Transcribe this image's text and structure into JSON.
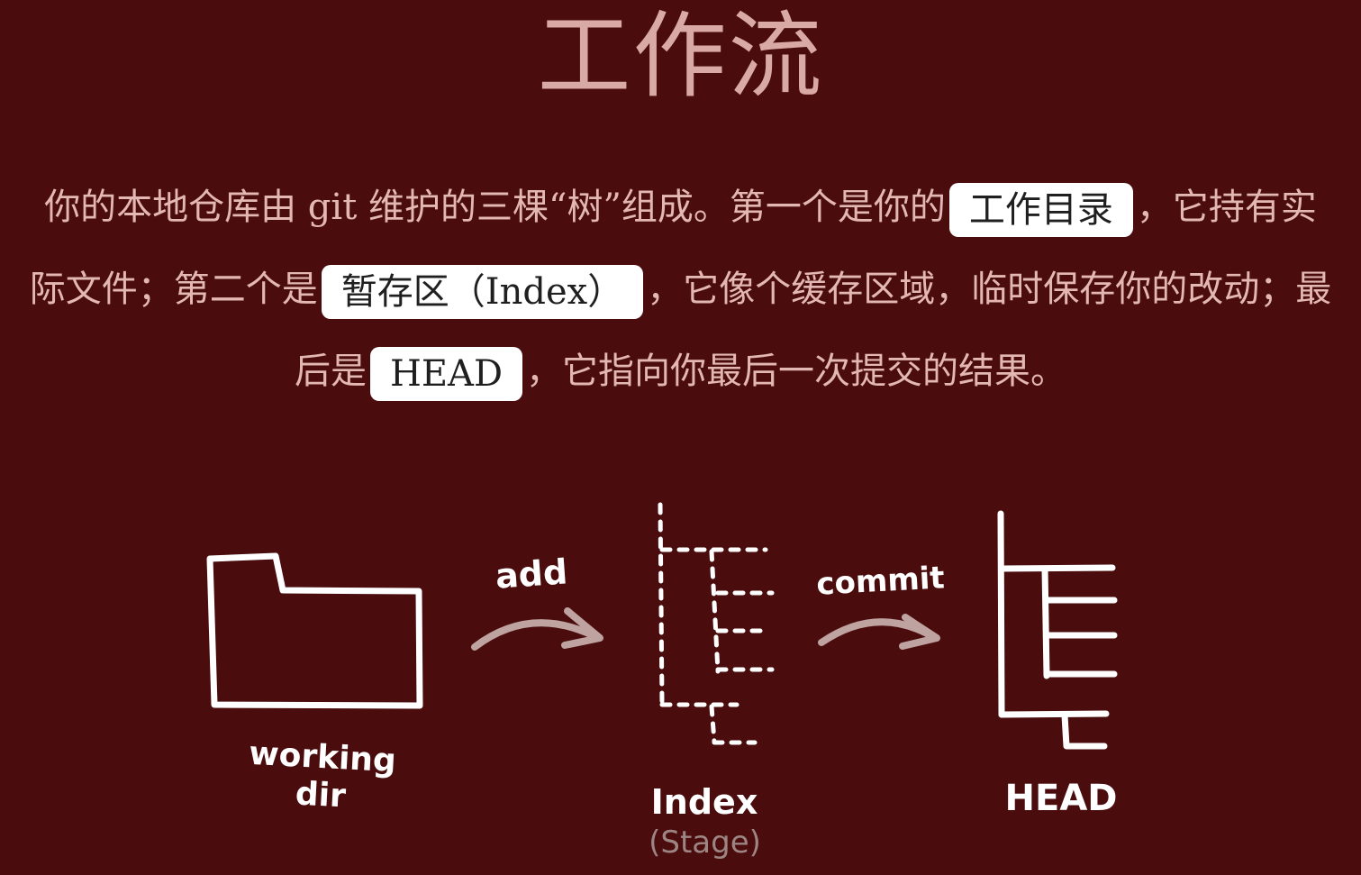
{
  "title": "工作流",
  "intro": {
    "part1": "你的本地仓库由 git 维护的三棵“树”组成。第一个是你的",
    "chip_working": "工作目录",
    "part2": "，它持有实际文件；第二个是",
    "chip_index": "暂存区（Index）",
    "part3": "，它像个缓存区域，临时保存你的改动；最后是",
    "chip_head": "HEAD",
    "part4": "，它指向你最后一次提交的结果。"
  },
  "diagram": {
    "labels": {
      "add": "add",
      "commit": "commit",
      "working_dir": "working dir",
      "index": "Index",
      "stage": "(Stage)",
      "head": "HEAD"
    },
    "colors": {
      "stroke": "#ffffff",
      "arrow": "#bfa3a1",
      "background": "#4a0c0c"
    }
  }
}
